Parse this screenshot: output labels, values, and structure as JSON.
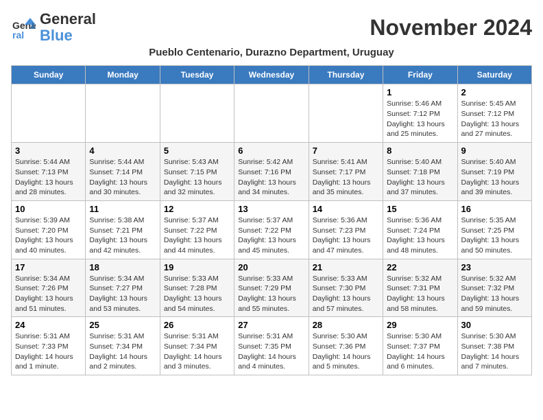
{
  "logo": {
    "text_general": "General",
    "text_blue": "Blue"
  },
  "header": {
    "month_title": "November 2024",
    "subtitle": "Pueblo Centenario, Durazno Department, Uruguay"
  },
  "weekdays": [
    "Sunday",
    "Monday",
    "Tuesday",
    "Wednesday",
    "Thursday",
    "Friday",
    "Saturday"
  ],
  "weeks": [
    [
      {
        "day": "",
        "info": ""
      },
      {
        "day": "",
        "info": ""
      },
      {
        "day": "",
        "info": ""
      },
      {
        "day": "",
        "info": ""
      },
      {
        "day": "",
        "info": ""
      },
      {
        "day": "1",
        "info": "Sunrise: 5:46 AM\nSunset: 7:12 PM\nDaylight: 13 hours and 25 minutes."
      },
      {
        "day": "2",
        "info": "Sunrise: 5:45 AM\nSunset: 7:12 PM\nDaylight: 13 hours and 27 minutes."
      }
    ],
    [
      {
        "day": "3",
        "info": "Sunrise: 5:44 AM\nSunset: 7:13 PM\nDaylight: 13 hours and 28 minutes."
      },
      {
        "day": "4",
        "info": "Sunrise: 5:44 AM\nSunset: 7:14 PM\nDaylight: 13 hours and 30 minutes."
      },
      {
        "day": "5",
        "info": "Sunrise: 5:43 AM\nSunset: 7:15 PM\nDaylight: 13 hours and 32 minutes."
      },
      {
        "day": "6",
        "info": "Sunrise: 5:42 AM\nSunset: 7:16 PM\nDaylight: 13 hours and 34 minutes."
      },
      {
        "day": "7",
        "info": "Sunrise: 5:41 AM\nSunset: 7:17 PM\nDaylight: 13 hours and 35 minutes."
      },
      {
        "day": "8",
        "info": "Sunrise: 5:40 AM\nSunset: 7:18 PM\nDaylight: 13 hours and 37 minutes."
      },
      {
        "day": "9",
        "info": "Sunrise: 5:40 AM\nSunset: 7:19 PM\nDaylight: 13 hours and 39 minutes."
      }
    ],
    [
      {
        "day": "10",
        "info": "Sunrise: 5:39 AM\nSunset: 7:20 PM\nDaylight: 13 hours and 40 minutes."
      },
      {
        "day": "11",
        "info": "Sunrise: 5:38 AM\nSunset: 7:21 PM\nDaylight: 13 hours and 42 minutes."
      },
      {
        "day": "12",
        "info": "Sunrise: 5:37 AM\nSunset: 7:22 PM\nDaylight: 13 hours and 44 minutes."
      },
      {
        "day": "13",
        "info": "Sunrise: 5:37 AM\nSunset: 7:22 PM\nDaylight: 13 hours and 45 minutes."
      },
      {
        "day": "14",
        "info": "Sunrise: 5:36 AM\nSunset: 7:23 PM\nDaylight: 13 hours and 47 minutes."
      },
      {
        "day": "15",
        "info": "Sunrise: 5:36 AM\nSunset: 7:24 PM\nDaylight: 13 hours and 48 minutes."
      },
      {
        "day": "16",
        "info": "Sunrise: 5:35 AM\nSunset: 7:25 PM\nDaylight: 13 hours and 50 minutes."
      }
    ],
    [
      {
        "day": "17",
        "info": "Sunrise: 5:34 AM\nSunset: 7:26 PM\nDaylight: 13 hours and 51 minutes."
      },
      {
        "day": "18",
        "info": "Sunrise: 5:34 AM\nSunset: 7:27 PM\nDaylight: 13 hours and 53 minutes."
      },
      {
        "day": "19",
        "info": "Sunrise: 5:33 AM\nSunset: 7:28 PM\nDaylight: 13 hours and 54 minutes."
      },
      {
        "day": "20",
        "info": "Sunrise: 5:33 AM\nSunset: 7:29 PM\nDaylight: 13 hours and 55 minutes."
      },
      {
        "day": "21",
        "info": "Sunrise: 5:33 AM\nSunset: 7:30 PM\nDaylight: 13 hours and 57 minutes."
      },
      {
        "day": "22",
        "info": "Sunrise: 5:32 AM\nSunset: 7:31 PM\nDaylight: 13 hours and 58 minutes."
      },
      {
        "day": "23",
        "info": "Sunrise: 5:32 AM\nSunset: 7:32 PM\nDaylight: 13 hours and 59 minutes."
      }
    ],
    [
      {
        "day": "24",
        "info": "Sunrise: 5:31 AM\nSunset: 7:33 PM\nDaylight: 14 hours and 1 minute."
      },
      {
        "day": "25",
        "info": "Sunrise: 5:31 AM\nSunset: 7:34 PM\nDaylight: 14 hours and 2 minutes."
      },
      {
        "day": "26",
        "info": "Sunrise: 5:31 AM\nSunset: 7:34 PM\nDaylight: 14 hours and 3 minutes."
      },
      {
        "day": "27",
        "info": "Sunrise: 5:31 AM\nSunset: 7:35 PM\nDaylight: 14 hours and 4 minutes."
      },
      {
        "day": "28",
        "info": "Sunrise: 5:30 AM\nSunset: 7:36 PM\nDaylight: 14 hours and 5 minutes."
      },
      {
        "day": "29",
        "info": "Sunrise: 5:30 AM\nSunset: 7:37 PM\nDaylight: 14 hours and 6 minutes."
      },
      {
        "day": "30",
        "info": "Sunrise: 5:30 AM\nSunset: 7:38 PM\nDaylight: 14 hours and 7 minutes."
      }
    ]
  ]
}
